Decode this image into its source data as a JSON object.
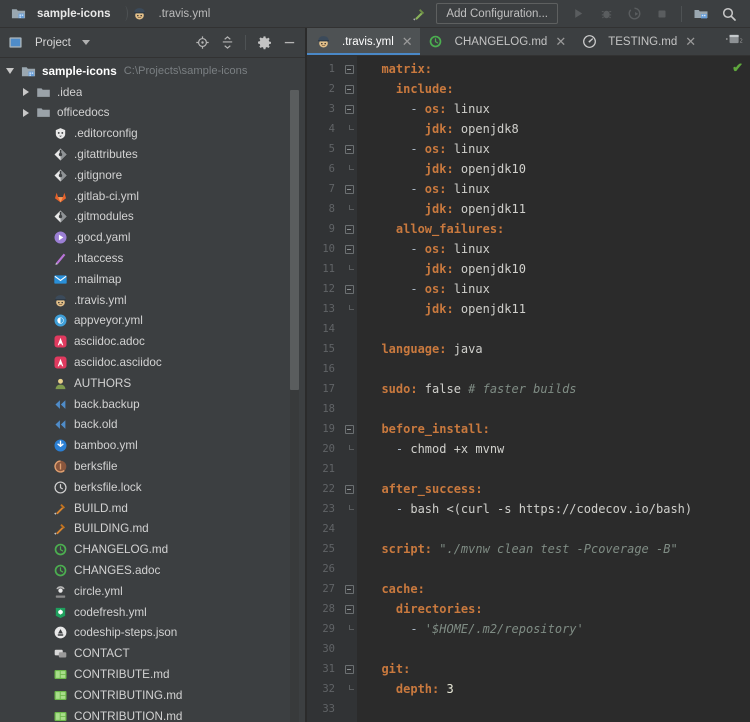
{
  "breadcrumb": {
    "root": "sample-icons",
    "file": ".travis.yml"
  },
  "toolbar": {
    "build_icon": "hammer-icon",
    "add_configuration_label": "Add Configuration...",
    "run_icon": "run-icon",
    "debug_icon": "debug-icon",
    "run_coverage_icon": "run-with-coverage-icon",
    "stop_icon": "stop-icon",
    "project_structure_icon": "project-structure-icon",
    "search_icon": "search-everywhere-icon"
  },
  "panel": {
    "title": "Project",
    "tools": {
      "locate": "locate-icon",
      "collapse_all": "collapse-all-icon",
      "settings": "gear-icon",
      "hide": "minimize-icon"
    }
  },
  "tree": [
    {
      "label": "sample-icons",
      "path": "C:\\Projects\\sample-icons",
      "indent": 0,
      "arrow": "open",
      "icon": "project-folder-icon",
      "icon_type": "project",
      "root": true
    },
    {
      "label": ".idea",
      "indent": 1,
      "arrow": "closed",
      "icon": "folder-icon",
      "icon_type": "folder"
    },
    {
      "label": "officedocs",
      "indent": 1,
      "arrow": "closed",
      "icon": "folder-icon",
      "icon_type": "folder"
    },
    {
      "label": ".editorconfig",
      "indent": 2,
      "arrow": "none",
      "icon": "editorconfig-icon",
      "icon_type": "editorconfig"
    },
    {
      "label": ".gitattributes",
      "indent": 2,
      "arrow": "none",
      "icon": "git-icon",
      "icon_type": "git"
    },
    {
      "label": ".gitignore",
      "indent": 2,
      "arrow": "none",
      "icon": "git-icon",
      "icon_type": "git"
    },
    {
      "label": ".gitlab-ci.yml",
      "indent": 2,
      "arrow": "none",
      "icon": "gitlab-icon",
      "icon_type": "gitlab"
    },
    {
      "label": ".gitmodules",
      "indent": 2,
      "arrow": "none",
      "icon": "git-icon",
      "icon_type": "git"
    },
    {
      "label": ".gocd.yaml",
      "indent": 2,
      "arrow": "none",
      "icon": "gocd-icon",
      "icon_type": "gocd"
    },
    {
      "label": ".htaccess",
      "indent": 2,
      "arrow": "none",
      "icon": "htaccess-icon",
      "icon_type": "htaccess"
    },
    {
      "label": ".mailmap",
      "indent": 2,
      "arrow": "none",
      "icon": "mail-icon",
      "icon_type": "mail"
    },
    {
      "label": ".travis.yml",
      "indent": 2,
      "arrow": "none",
      "icon": "travis-icon",
      "icon_type": "travis"
    },
    {
      "label": "appveyor.yml",
      "indent": 2,
      "arrow": "none",
      "icon": "appveyor-icon",
      "icon_type": "appveyor"
    },
    {
      "label": "asciidoc.adoc",
      "indent": 2,
      "arrow": "none",
      "icon": "asciidoc-icon",
      "icon_type": "asciidoc"
    },
    {
      "label": "asciidoc.asciidoc",
      "indent": 2,
      "arrow": "none",
      "icon": "asciidoc-icon",
      "icon_type": "asciidoc"
    },
    {
      "label": "AUTHORS",
      "indent": 2,
      "arrow": "none",
      "icon": "authors-icon",
      "icon_type": "authors"
    },
    {
      "label": "back.backup",
      "indent": 2,
      "arrow": "none",
      "icon": "backup-icon",
      "icon_type": "backup"
    },
    {
      "label": "back.old",
      "indent": 2,
      "arrow": "none",
      "icon": "backup-icon",
      "icon_type": "backup"
    },
    {
      "label": "bamboo.yml",
      "indent": 2,
      "arrow": "none",
      "icon": "bamboo-icon",
      "icon_type": "bamboo"
    },
    {
      "label": "berksfile",
      "indent": 2,
      "arrow": "none",
      "icon": "berksfile-icon",
      "icon_type": "berks"
    },
    {
      "label": "berksfile.lock",
      "indent": 2,
      "arrow": "none",
      "icon": "berksfile-icon",
      "icon_type": "berkslock"
    },
    {
      "label": "BUILD.md",
      "indent": 2,
      "arrow": "none",
      "icon": "build-icon",
      "icon_type": "build"
    },
    {
      "label": "BUILDING.md",
      "indent": 2,
      "arrow": "none",
      "icon": "build-icon",
      "icon_type": "build"
    },
    {
      "label": "CHANGELOG.md",
      "indent": 2,
      "arrow": "none",
      "icon": "changelog-icon",
      "icon_type": "changelog"
    },
    {
      "label": "CHANGES.adoc",
      "indent": 2,
      "arrow": "none",
      "icon": "changelog-icon",
      "icon_type": "changelog"
    },
    {
      "label": "circle.yml",
      "indent": 2,
      "arrow": "none",
      "icon": "circleci-icon",
      "icon_type": "circle"
    },
    {
      "label": "codefresh.yml",
      "indent": 2,
      "arrow": "none",
      "icon": "codefresh-icon",
      "icon_type": "codefresh"
    },
    {
      "label": "codeship-steps.json",
      "indent": 2,
      "arrow": "none",
      "icon": "codeship-icon",
      "icon_type": "codeship"
    },
    {
      "label": "CONTACT",
      "indent": 2,
      "arrow": "none",
      "icon": "contact-icon",
      "icon_type": "contact"
    },
    {
      "label": "CONTRIBUTE.md",
      "indent": 2,
      "arrow": "none",
      "icon": "contribute-icon",
      "icon_type": "contribute"
    },
    {
      "label": "CONTRIBUTING.md",
      "indent": 2,
      "arrow": "none",
      "icon": "contribute-icon",
      "icon_type": "contribute"
    },
    {
      "label": "CONTRIBUTION.md",
      "indent": 2,
      "arrow": "none",
      "icon": "contribute-icon",
      "icon_type": "contribute"
    }
  ],
  "tabs": [
    {
      "label": ".travis.yml",
      "icon": "travis-icon",
      "icon_type": "travis",
      "active": true
    },
    {
      "label": "CHANGELOG.md",
      "icon": "changelog-icon",
      "icon_type": "changelog",
      "active": false
    },
    {
      "label": "TESTING.md",
      "icon": "testing-icon",
      "icon_type": "testing",
      "active": false
    }
  ],
  "editor": {
    "inspection_status": "✔",
    "tab_list_icon": "tab-list-icon",
    "first_line": 1,
    "last_line": 33,
    "lines": [
      {
        "n": 1,
        "fold": "start",
        "tokens": [
          {
            "t": "  ",
            "c": "v"
          },
          {
            "t": "matrix:",
            "c": "k"
          }
        ]
      },
      {
        "n": 2,
        "fold": "start",
        "tokens": [
          {
            "t": "    ",
            "c": "v"
          },
          {
            "t": "include:",
            "c": "k"
          }
        ]
      },
      {
        "n": 3,
        "fold": "start",
        "tokens": [
          {
            "t": "      - ",
            "c": "d"
          },
          {
            "t": "os:",
            "c": "k"
          },
          {
            "t": " linux",
            "c": "v"
          }
        ]
      },
      {
        "n": 4,
        "fold": "end",
        "tokens": [
          {
            "t": "        ",
            "c": "v"
          },
          {
            "t": "jdk:",
            "c": "k"
          },
          {
            "t": " openjdk8",
            "c": "v"
          }
        ]
      },
      {
        "n": 5,
        "fold": "start",
        "tokens": [
          {
            "t": "      - ",
            "c": "d"
          },
          {
            "t": "os:",
            "c": "k"
          },
          {
            "t": " linux",
            "c": "v"
          }
        ]
      },
      {
        "n": 6,
        "fold": "end",
        "tokens": [
          {
            "t": "        ",
            "c": "v"
          },
          {
            "t": "jdk:",
            "c": "k"
          },
          {
            "t": " openjdk10",
            "c": "v"
          }
        ]
      },
      {
        "n": 7,
        "fold": "start",
        "tokens": [
          {
            "t": "      - ",
            "c": "d"
          },
          {
            "t": "os:",
            "c": "k"
          },
          {
            "t": " linux",
            "c": "v"
          }
        ]
      },
      {
        "n": 8,
        "fold": "end",
        "tokens": [
          {
            "t": "        ",
            "c": "v"
          },
          {
            "t": "jdk:",
            "c": "k"
          },
          {
            "t": " openjdk11",
            "c": "v"
          }
        ]
      },
      {
        "n": 9,
        "fold": "start",
        "tokens": [
          {
            "t": "    ",
            "c": "v"
          },
          {
            "t": "allow_failures:",
            "c": "k"
          }
        ]
      },
      {
        "n": 10,
        "fold": "start",
        "tokens": [
          {
            "t": "      - ",
            "c": "d"
          },
          {
            "t": "os:",
            "c": "k"
          },
          {
            "t": " linux",
            "c": "v"
          }
        ]
      },
      {
        "n": 11,
        "fold": "end",
        "tokens": [
          {
            "t": "        ",
            "c": "v"
          },
          {
            "t": "jdk:",
            "c": "k"
          },
          {
            "t": " openjdk10",
            "c": "v"
          }
        ]
      },
      {
        "n": 12,
        "fold": "start",
        "tokens": [
          {
            "t": "      - ",
            "c": "d"
          },
          {
            "t": "os:",
            "c": "k"
          },
          {
            "t": " linux",
            "c": "v"
          }
        ]
      },
      {
        "n": 13,
        "fold": "end",
        "tokens": [
          {
            "t": "        ",
            "c": "v"
          },
          {
            "t": "jdk:",
            "c": "k"
          },
          {
            "t": " openjdk11",
            "c": "v"
          }
        ]
      },
      {
        "n": 14,
        "fold": "none",
        "tokens": []
      },
      {
        "n": 15,
        "fold": "none",
        "tokens": [
          {
            "t": "  ",
            "c": "v"
          },
          {
            "t": "language:",
            "c": "k"
          },
          {
            "t": " java",
            "c": "v"
          }
        ]
      },
      {
        "n": 16,
        "fold": "none",
        "tokens": []
      },
      {
        "n": 17,
        "fold": "none",
        "tokens": [
          {
            "t": "  ",
            "c": "v"
          },
          {
            "t": "sudo:",
            "c": "k"
          },
          {
            "t": " false ",
            "c": "v"
          },
          {
            "t": "# faster builds",
            "c": "cm"
          }
        ]
      },
      {
        "n": 18,
        "fold": "none",
        "tokens": []
      },
      {
        "n": 19,
        "fold": "start",
        "tokens": [
          {
            "t": "  ",
            "c": "v"
          },
          {
            "t": "before_install:",
            "c": "k"
          }
        ]
      },
      {
        "n": 20,
        "fold": "end",
        "tokens": [
          {
            "t": "    - ",
            "c": "d"
          },
          {
            "t": "chmod +x mvnw",
            "c": "v"
          }
        ]
      },
      {
        "n": 21,
        "fold": "none",
        "tokens": []
      },
      {
        "n": 22,
        "fold": "start",
        "tokens": [
          {
            "t": "  ",
            "c": "v"
          },
          {
            "t": "after_success:",
            "c": "k"
          }
        ]
      },
      {
        "n": 23,
        "fold": "end",
        "tokens": [
          {
            "t": "    - ",
            "c": "d"
          },
          {
            "t": "bash <(curl -s https://codecov.io/bash)",
            "c": "v"
          }
        ]
      },
      {
        "n": 24,
        "fold": "none",
        "tokens": []
      },
      {
        "n": 25,
        "fold": "none",
        "tokens": [
          {
            "t": "  ",
            "c": "v"
          },
          {
            "t": "script:",
            "c": "k"
          },
          {
            "t": " \"./mvnw clean test -Pcoverage -B\"",
            "c": "st"
          }
        ]
      },
      {
        "n": 26,
        "fold": "none",
        "tokens": []
      },
      {
        "n": 27,
        "fold": "start",
        "tokens": [
          {
            "t": "  ",
            "c": "v"
          },
          {
            "t": "cache:",
            "c": "k"
          }
        ]
      },
      {
        "n": 28,
        "fold": "start",
        "tokens": [
          {
            "t": "    ",
            "c": "v"
          },
          {
            "t": "directories:",
            "c": "k"
          }
        ]
      },
      {
        "n": 29,
        "fold": "end",
        "tokens": [
          {
            "t": "      - ",
            "c": "d"
          },
          {
            "t": "'$HOME/.m2/repository'",
            "c": "st"
          }
        ]
      },
      {
        "n": 30,
        "fold": "none",
        "tokens": []
      },
      {
        "n": 31,
        "fold": "start",
        "tokens": [
          {
            "t": "  ",
            "c": "v"
          },
          {
            "t": "git:",
            "c": "k"
          }
        ]
      },
      {
        "n": 32,
        "fold": "end",
        "tokens": [
          {
            "t": "    ",
            "c": "v"
          },
          {
            "t": "depth:",
            "c": "k"
          },
          {
            "t": " 3",
            "c": "num"
          }
        ]
      },
      {
        "n": 33,
        "fold": "none",
        "tokens": []
      }
    ]
  },
  "colors": {
    "chrome": "#3c3f41",
    "editor_bg": "#2b2b2b",
    "gutter_bg": "#313335",
    "active_tab": "#4e5254",
    "accent_blue": "#4a88c7",
    "key_orange": "#c9793e",
    "comment_gray": "#7f8c84",
    "check_green": "#5fa83d"
  }
}
